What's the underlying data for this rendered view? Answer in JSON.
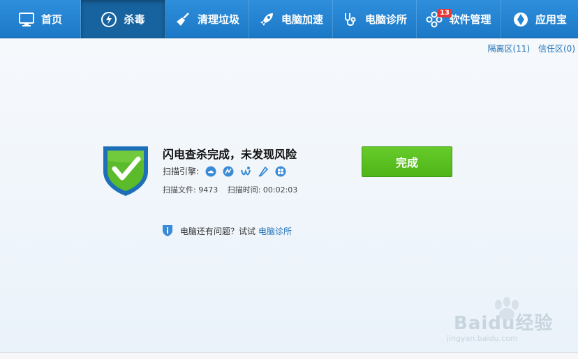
{
  "nav": {
    "items": [
      {
        "label": "首页",
        "icon": "monitor-icon"
      },
      {
        "label": "杀毒",
        "icon": "lightning-shield-icon",
        "active": true
      },
      {
        "label": "清理垃圾",
        "icon": "broom-icon"
      },
      {
        "label": "电脑加速",
        "icon": "rocket-icon"
      },
      {
        "label": "电脑诊所",
        "icon": "stethoscope-icon"
      },
      {
        "label": "软件管理",
        "icon": "software-grid-icon",
        "badge": "13"
      },
      {
        "label": "应用宝",
        "icon": "app-store-icon"
      }
    ]
  },
  "zones": {
    "quarantine": "隔离区(11)",
    "trust": "信任区(0)"
  },
  "scan": {
    "title": "闪电查杀完成，未发现风险",
    "engines_label": "扫描引擎:",
    "files_label": "扫描文件: 9473",
    "time_label": "扫描时间: 00:02:03"
  },
  "done_button": "完成",
  "tip": {
    "text": "电脑还有问题？试试",
    "link": "电脑诊所"
  },
  "watermark": {
    "text": "Baidu经验",
    "url": "jingyan.baidu.com"
  },
  "colors": {
    "nav_bg": "#2387d6",
    "nav_active": "#17639f",
    "done_green": "#58be21",
    "link_blue": "#1f6fb5",
    "shield_blue": "#1d6fb8",
    "shield_green": "#5cbb2a"
  }
}
